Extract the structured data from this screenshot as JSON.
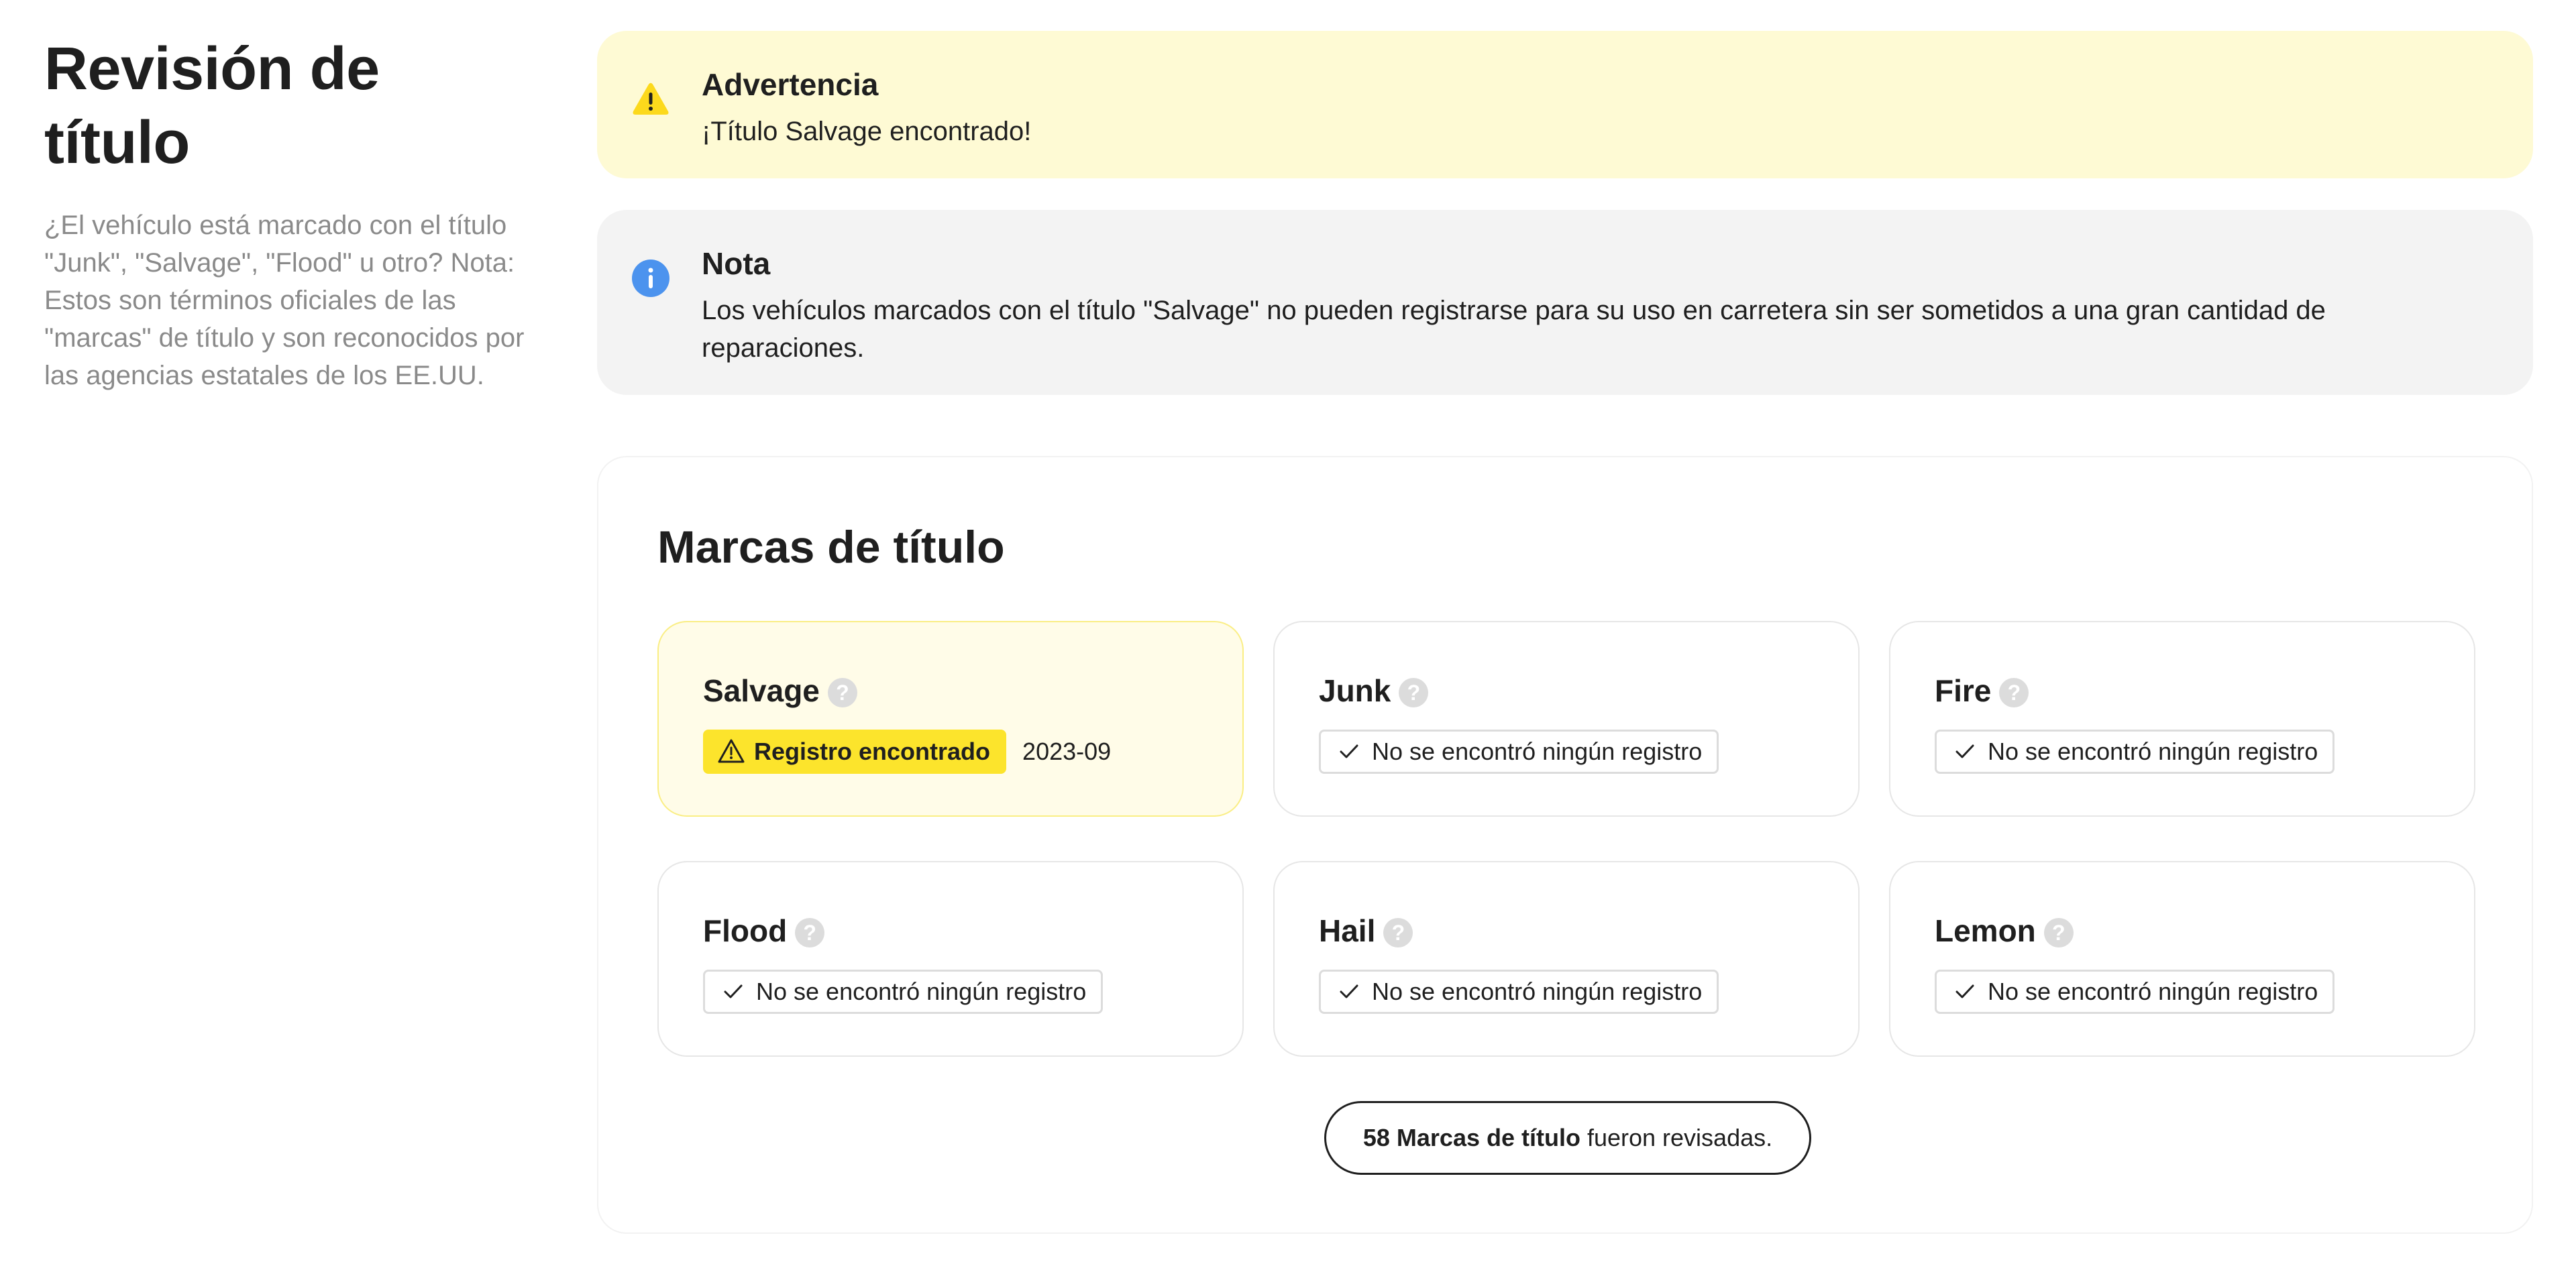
{
  "sidebar": {
    "title": "Revisión de título",
    "description": "¿El vehículo está marcado con el título \"Junk\", \"Salvage\", \"Flood\" u otro? Nota: Estos son términos oficiales de las \"marcas\" de título y son reconocidos por las agencias estatales de los EE.UU."
  },
  "alerts": {
    "warning": {
      "icon": "warning-triangle-icon",
      "title": "Advertencia",
      "text": "¡Título Salvage encontrado!"
    },
    "note": {
      "icon": "info-icon",
      "title": "Nota",
      "text": "Los vehículos marcados con el título \"Salvage\" no pueden registrarse para su uso en carretera sin ser sometidos a una gran cantidad de reparaciones."
    }
  },
  "brands": {
    "title": "Marcas de título",
    "help_glyph": "?",
    "found_label": "Registro encontrado",
    "clear_label": "No se encontró ningún registro",
    "cards": [
      {
        "name": "Salvage",
        "status": "found",
        "date": "2023-09"
      },
      {
        "name": "Junk",
        "status": "clear"
      },
      {
        "name": "Fire",
        "status": "clear"
      },
      {
        "name": "Flood",
        "status": "clear"
      },
      {
        "name": "Hail",
        "status": "clear"
      },
      {
        "name": "Lemon",
        "status": "clear"
      }
    ],
    "summary": {
      "bold": "58 Marcas de título",
      "rest": " fueron revisadas."
    }
  },
  "colors": {
    "warning_bg": "#fefad4",
    "note_bg": "#f3f3f3",
    "warning_icon": "#fcd91c",
    "info_icon": "#4c93ee",
    "found_badge": "#fce42c",
    "flagged_card_bg": "#fffce8",
    "flagged_card_border": "#faee84"
  }
}
